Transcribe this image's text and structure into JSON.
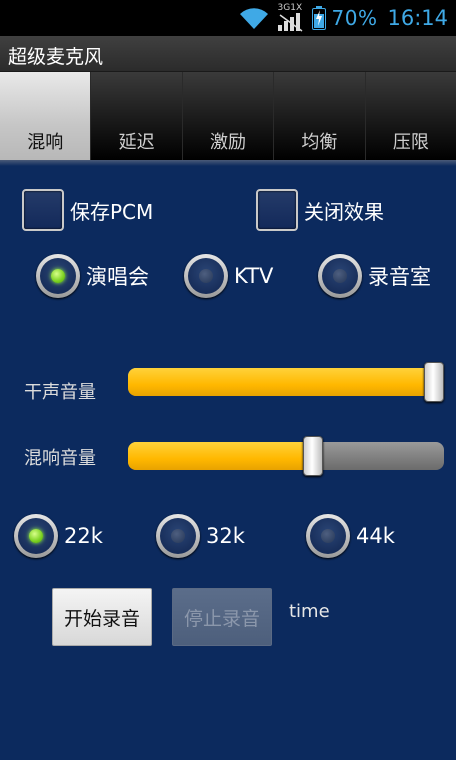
{
  "status_bar": {
    "network": "3G1X",
    "battery": "70%",
    "clock": "16:14"
  },
  "app": {
    "title": "超级麦克风"
  },
  "tabs": [
    {
      "label": "混响",
      "active": true
    },
    {
      "label": "延迟",
      "active": false
    },
    {
      "label": "激励",
      "active": false
    },
    {
      "label": "均衡",
      "active": false
    },
    {
      "label": "压限",
      "active": false
    }
  ],
  "options": {
    "save_pcm": {
      "label": "保存PCM",
      "checked": false
    },
    "disable_effect": {
      "label": "关闭效果",
      "checked": false
    }
  },
  "presets": {
    "selected": "演唱会",
    "items": [
      "演唱会",
      "KTV",
      "录音室"
    ]
  },
  "sliders": {
    "dry_volume": {
      "label": "干声音量",
      "value_percent": 100
    },
    "reverb_volume": {
      "label": "混响音量",
      "value_percent": 59
    }
  },
  "sample_rate": {
    "selected": "22k",
    "items": [
      "22k",
      "32k",
      "44k"
    ]
  },
  "buttons": {
    "start_record": "开始录音",
    "stop_record": "停止录音"
  },
  "time_label": "time"
}
